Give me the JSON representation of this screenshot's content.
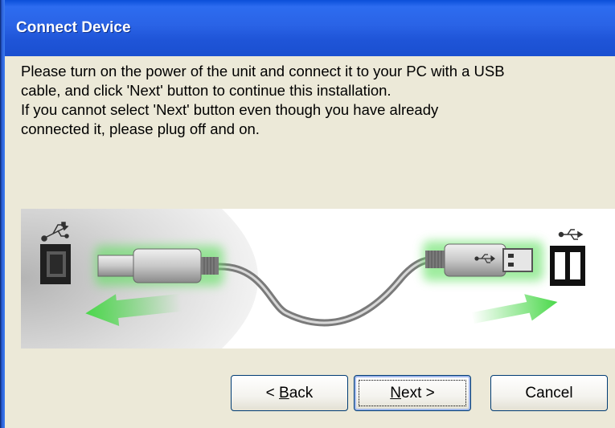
{
  "dialog": {
    "title": "Connect Device",
    "message_lines": [
      "Please turn on the power of the unit and connect it to your PC with a USB",
      "cable, and click 'Next' button to continue this installation.",
      "If you cannot select 'Next' button even though you have already",
      "connected it, please plug off and on."
    ]
  },
  "buttons": {
    "back": {
      "prefix": "< ",
      "mnemonic": "B",
      "rest": "ack"
    },
    "next": {
      "mnemonic": "N",
      "rest": "ext >"
    },
    "cancel": {
      "label": "Cancel"
    }
  },
  "icons": {
    "left_usb_symbol": "usb-symbol-icon",
    "right_usb_symbol": "usb-symbol-icon",
    "cable_plug_usb_symbol": "usb-symbol-icon",
    "device_port": "usb-b-port-icon",
    "pc_port": "usb-a-port-icon"
  },
  "colors": {
    "title_bar": "#2a63e6",
    "dialog_bg": "#ece9d8",
    "arrow_green": "#4ad84a",
    "button_border": "#003c74"
  }
}
